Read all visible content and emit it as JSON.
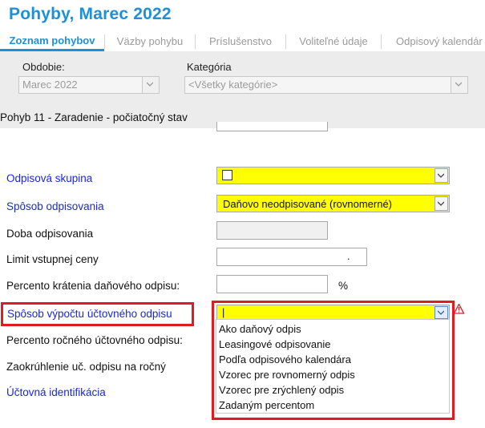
{
  "header": {
    "title": "Pohyby, Marec 2022"
  },
  "tabs": [
    {
      "label": "Zoznam pohybov",
      "active": true
    },
    {
      "label": "Väzby pohybu"
    },
    {
      "label": "Príslušenstvo"
    },
    {
      "label": "Voliteľné údaje"
    },
    {
      "label": "Odpisový kalendár"
    }
  ],
  "filters": {
    "period_label": "Obdobie:",
    "period_value": "Marec 2022",
    "category_label": "Kategória",
    "category_value": "<Všetky kategórie>"
  },
  "section": {
    "title": "Pohyb 11 - Zaradenie - počiatočný stav"
  },
  "form": {
    "odpisova_skupina": {
      "label": "Odpisová skupina"
    },
    "sposob_odpisovania": {
      "label": "Spôsob odpisovania",
      "value": "Daňovo neodpisované (rovnomerné)"
    },
    "doba_odpisovania": {
      "label": "Doba odpisovania"
    },
    "limit_vstupnej_ceny": {
      "label": "Limit vstupnej ceny",
      "value": "."
    },
    "percento_kratenia": {
      "label": "Percento krátenia daňového odpisu:",
      "unit": "%"
    },
    "sposob_vypoctu": {
      "label": "Spôsob výpočtu účtovného odpisu",
      "value": "|"
    },
    "percento_rocneho": {
      "label": "Percento ročného účtovného odpisu:"
    },
    "zaokruhlenie": {
      "label": "Zaokrúhlenie uč. odpisu na ročný"
    },
    "uctovna_identifikacia": {
      "label": "Účtovná identifikácia"
    }
  },
  "dropdown_options": [
    "Ako daňový odpis",
    "Leasingové odpisovanie",
    "Podľa odpisového kalendára",
    "Vzorec pre rovnomerný odpis",
    "Vzorec pre zrýchlený odpis",
    "Zadaným percentom"
  ],
  "colors": {
    "accent": "#1f8fd6",
    "link_label": "#1a27e0",
    "highlight": "#ffff00",
    "annotation_red": "#e01b23",
    "panel_gray": "#ececec"
  }
}
